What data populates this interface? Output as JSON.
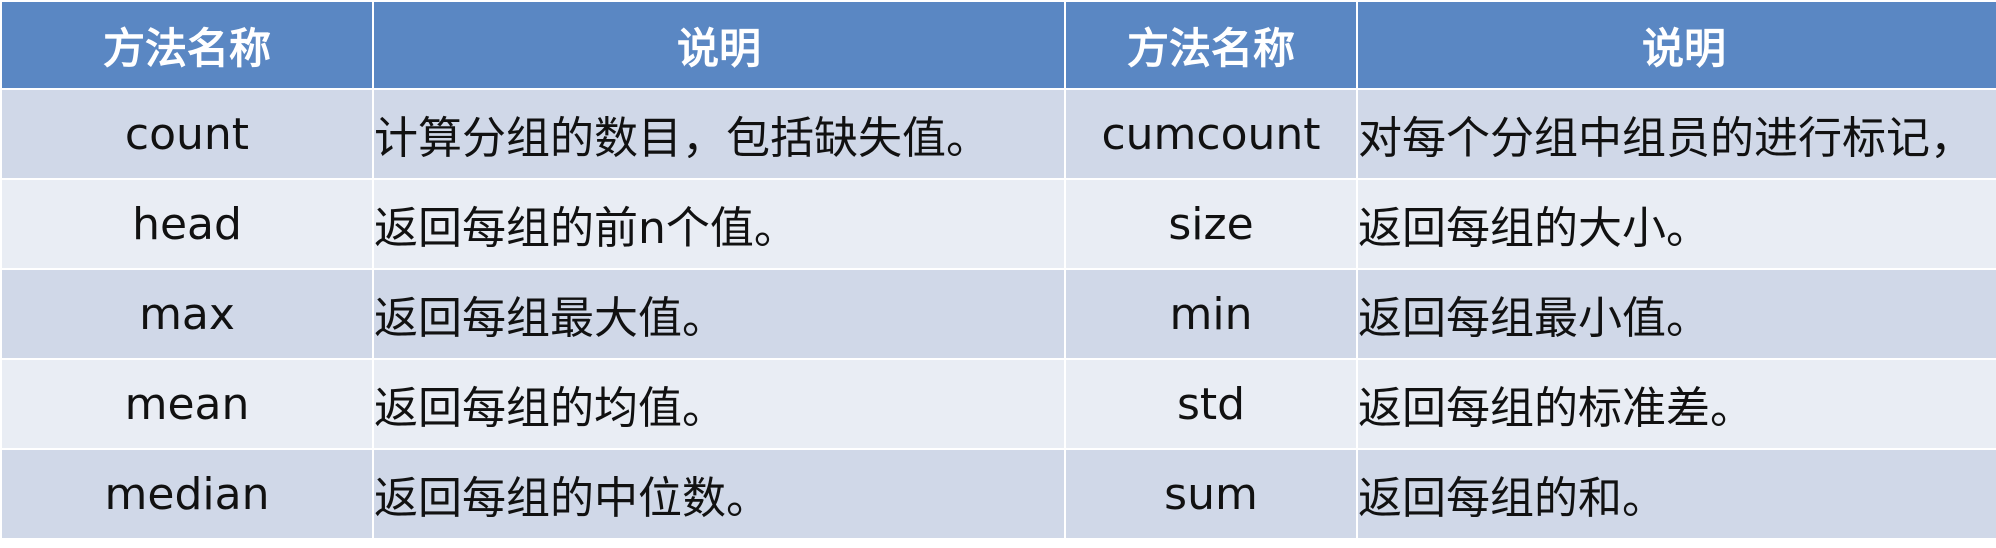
{
  "table": {
    "headers": [
      "方法名称",
      "说明",
      "方法名称",
      "说明"
    ],
    "rows": [
      {
        "name1": "count",
        "desc1": "计算分组的数目，包括缺失值。",
        "name2": "cumcount",
        "desc2": "对每个分组中组员的进行标记，"
      },
      {
        "name1": "head",
        "desc1": "返回每组的前n个值。",
        "name2": "size",
        "desc2": "返回每组的大小。"
      },
      {
        "name1": "max",
        "desc1": "返回每组最大值。",
        "name2": "min",
        "desc2": "返回每组最小值。"
      },
      {
        "name1": "mean",
        "desc1": "返回每组的均值。",
        "name2": "std",
        "desc2": "返回每组的标准差。"
      },
      {
        "name1": "median",
        "desc1": "返回每组的中位数。",
        "name2": "sum",
        "desc2": "返回每组的和。"
      }
    ]
  },
  "colors": {
    "header_bg": "#5a87c3",
    "row_odd_bg": "#d0d8e8",
    "row_even_bg": "#e9edf4"
  }
}
